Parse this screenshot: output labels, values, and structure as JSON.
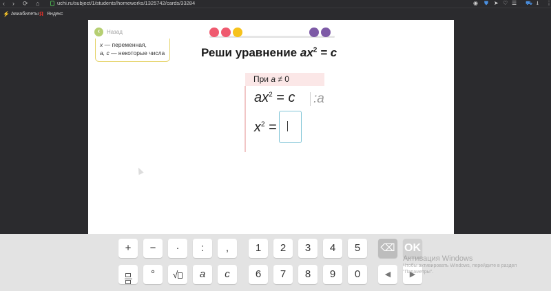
{
  "browser": {
    "url": "uchi.ru/subject/1/students/homeworks/1325742/cards/33284"
  },
  "bookmarks": [
    {
      "label": "Авиабилеты",
      "icon": "lightning-icon",
      "color": "#f5b400"
    },
    {
      "label": "Яндекс",
      "icon": "yandex-icon",
      "color": "#e8322b"
    }
  ],
  "card": {
    "back_label": "Назад",
    "hint_line1_var": "x",
    "hint_line1_rest": " — переменная,",
    "hint_line2_vars": "a, c",
    "hint_line2_rest": " — некоторые числа",
    "progress_colors": [
      "#ef5a6f",
      "#ef5a6f",
      "#f6c21c",
      "#7d5aa6",
      "#7d5aa6"
    ],
    "title_text": "Реши уравнение",
    "title_lhs": "ax",
    "title_exp": "2",
    "title_rhs": " = c",
    "condition_prefix": "При ",
    "condition_var": "a",
    "condition_rest": " ≠ 0",
    "eq1_lhs": "ax",
    "eq1_exp": "2",
    "eq1_mid": " = ",
    "eq1_rhs": "c",
    "divide_op": ":a",
    "eq2_lhs": "x",
    "eq2_exp": "2",
    "eq2_mid": " ="
  },
  "keyboard": {
    "row1_ops": [
      "+",
      "−",
      "·",
      ":",
      ","
    ],
    "row1_digits": [
      "1",
      "2",
      "3",
      "4",
      "5"
    ],
    "row2_ops": [
      "°",
      "a",
      "c"
    ],
    "row2_digits": [
      "6",
      "7",
      "8",
      "9",
      "0"
    ],
    "backspace_icon": "backspace-icon",
    "ok_label": "OK",
    "left_arrow": "◀",
    "right_arrow": "▶",
    "sqrt_label": "√"
  },
  "watermark": {
    "title": "Активация Windows",
    "line1": "Чтобы активировать Windows, перейдите в раздел",
    "line2": "\"Параметры\"."
  }
}
